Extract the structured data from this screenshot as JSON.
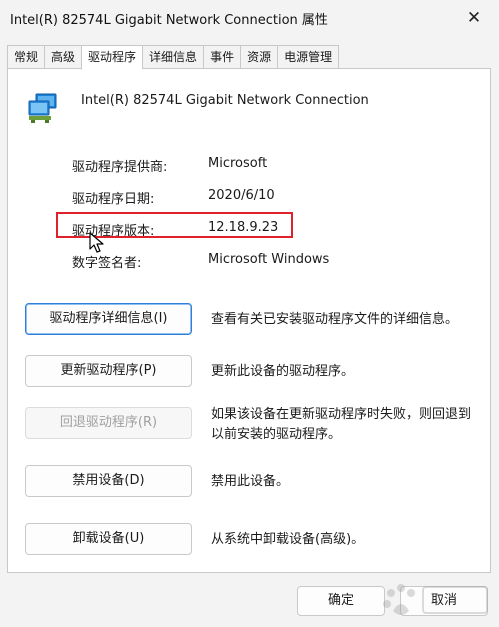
{
  "window": {
    "title": "Intel(R) 82574L Gigabit Network Connection 属性",
    "close_glyph": "✕"
  },
  "tabs": [
    {
      "label": "常规",
      "active": false
    },
    {
      "label": "高级",
      "active": false
    },
    {
      "label": "驱动程序",
      "active": true
    },
    {
      "label": "详细信息",
      "active": false
    },
    {
      "label": "事件",
      "active": false
    },
    {
      "label": "资源",
      "active": false
    },
    {
      "label": "电源管理",
      "active": false
    }
  ],
  "device": {
    "name": "Intel(R) 82574L Gigabit Network Connection",
    "icon": "network-adapter-icon"
  },
  "info": [
    {
      "label": "驱动程序提供商:",
      "value": "Microsoft"
    },
    {
      "label": "驱动程序日期:",
      "value": "2020/6/10"
    },
    {
      "label": "驱动程序版本:",
      "value": "12.18.9.23"
    },
    {
      "label": "数字签名者:",
      "value": "Microsoft Windows"
    }
  ],
  "actions": [
    {
      "label": "驱动程序详细信息(I)",
      "description": "查看有关已安装驱动程序文件的详细信息。",
      "enabled": true
    },
    {
      "label": "更新驱动程序(P)",
      "description": "更新此设备的驱动程序。",
      "enabled": true
    },
    {
      "label": "回退驱动程序(R)",
      "description": "如果该设备在更新驱动程序时失败，则回退到以前安装的驱动程序。",
      "enabled": false
    },
    {
      "label": "禁用设备(D)",
      "description": "禁用此设备。",
      "enabled": true
    },
    {
      "label": "卸载设备(U)",
      "description": "从系统中卸载设备(高级)。",
      "enabled": true
    }
  ],
  "footer": {
    "ok_label": "确定",
    "cancel_label": "取消"
  },
  "colors": {
    "highlight": "#e0202a",
    "accent": "#2f7ed8"
  }
}
